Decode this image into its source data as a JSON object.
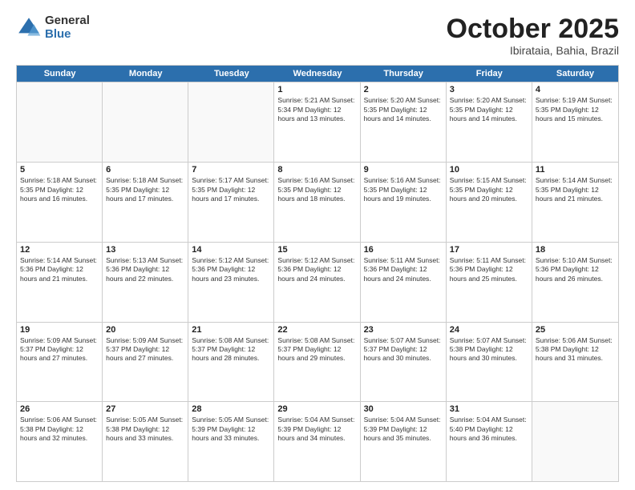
{
  "logo": {
    "general": "General",
    "blue": "Blue"
  },
  "header": {
    "month": "October 2025",
    "location": "Ibirataia, Bahia, Brazil"
  },
  "weekdays": [
    "Sunday",
    "Monday",
    "Tuesday",
    "Wednesday",
    "Thursday",
    "Friday",
    "Saturday"
  ],
  "weeks": [
    [
      {
        "day": "",
        "info": ""
      },
      {
        "day": "",
        "info": ""
      },
      {
        "day": "",
        "info": ""
      },
      {
        "day": "1",
        "info": "Sunrise: 5:21 AM\nSunset: 5:34 PM\nDaylight: 12 hours\nand 13 minutes."
      },
      {
        "day": "2",
        "info": "Sunrise: 5:20 AM\nSunset: 5:35 PM\nDaylight: 12 hours\nand 14 minutes."
      },
      {
        "day": "3",
        "info": "Sunrise: 5:20 AM\nSunset: 5:35 PM\nDaylight: 12 hours\nand 14 minutes."
      },
      {
        "day": "4",
        "info": "Sunrise: 5:19 AM\nSunset: 5:35 PM\nDaylight: 12 hours\nand 15 minutes."
      }
    ],
    [
      {
        "day": "5",
        "info": "Sunrise: 5:18 AM\nSunset: 5:35 PM\nDaylight: 12 hours\nand 16 minutes."
      },
      {
        "day": "6",
        "info": "Sunrise: 5:18 AM\nSunset: 5:35 PM\nDaylight: 12 hours\nand 17 minutes."
      },
      {
        "day": "7",
        "info": "Sunrise: 5:17 AM\nSunset: 5:35 PM\nDaylight: 12 hours\nand 17 minutes."
      },
      {
        "day": "8",
        "info": "Sunrise: 5:16 AM\nSunset: 5:35 PM\nDaylight: 12 hours\nand 18 minutes."
      },
      {
        "day": "9",
        "info": "Sunrise: 5:16 AM\nSunset: 5:35 PM\nDaylight: 12 hours\nand 19 minutes."
      },
      {
        "day": "10",
        "info": "Sunrise: 5:15 AM\nSunset: 5:35 PM\nDaylight: 12 hours\nand 20 minutes."
      },
      {
        "day": "11",
        "info": "Sunrise: 5:14 AM\nSunset: 5:35 PM\nDaylight: 12 hours\nand 21 minutes."
      }
    ],
    [
      {
        "day": "12",
        "info": "Sunrise: 5:14 AM\nSunset: 5:36 PM\nDaylight: 12 hours\nand 21 minutes."
      },
      {
        "day": "13",
        "info": "Sunrise: 5:13 AM\nSunset: 5:36 PM\nDaylight: 12 hours\nand 22 minutes."
      },
      {
        "day": "14",
        "info": "Sunrise: 5:12 AM\nSunset: 5:36 PM\nDaylight: 12 hours\nand 23 minutes."
      },
      {
        "day": "15",
        "info": "Sunrise: 5:12 AM\nSunset: 5:36 PM\nDaylight: 12 hours\nand 24 minutes."
      },
      {
        "day": "16",
        "info": "Sunrise: 5:11 AM\nSunset: 5:36 PM\nDaylight: 12 hours\nand 24 minutes."
      },
      {
        "day": "17",
        "info": "Sunrise: 5:11 AM\nSunset: 5:36 PM\nDaylight: 12 hours\nand 25 minutes."
      },
      {
        "day": "18",
        "info": "Sunrise: 5:10 AM\nSunset: 5:36 PM\nDaylight: 12 hours\nand 26 minutes."
      }
    ],
    [
      {
        "day": "19",
        "info": "Sunrise: 5:09 AM\nSunset: 5:37 PM\nDaylight: 12 hours\nand 27 minutes."
      },
      {
        "day": "20",
        "info": "Sunrise: 5:09 AM\nSunset: 5:37 PM\nDaylight: 12 hours\nand 27 minutes."
      },
      {
        "day": "21",
        "info": "Sunrise: 5:08 AM\nSunset: 5:37 PM\nDaylight: 12 hours\nand 28 minutes."
      },
      {
        "day": "22",
        "info": "Sunrise: 5:08 AM\nSunset: 5:37 PM\nDaylight: 12 hours\nand 29 minutes."
      },
      {
        "day": "23",
        "info": "Sunrise: 5:07 AM\nSunset: 5:37 PM\nDaylight: 12 hours\nand 30 minutes."
      },
      {
        "day": "24",
        "info": "Sunrise: 5:07 AM\nSunset: 5:38 PM\nDaylight: 12 hours\nand 30 minutes."
      },
      {
        "day": "25",
        "info": "Sunrise: 5:06 AM\nSunset: 5:38 PM\nDaylight: 12 hours\nand 31 minutes."
      }
    ],
    [
      {
        "day": "26",
        "info": "Sunrise: 5:06 AM\nSunset: 5:38 PM\nDaylight: 12 hours\nand 32 minutes."
      },
      {
        "day": "27",
        "info": "Sunrise: 5:05 AM\nSunset: 5:38 PM\nDaylight: 12 hours\nand 33 minutes."
      },
      {
        "day": "28",
        "info": "Sunrise: 5:05 AM\nSunset: 5:39 PM\nDaylight: 12 hours\nand 33 minutes."
      },
      {
        "day": "29",
        "info": "Sunrise: 5:04 AM\nSunset: 5:39 PM\nDaylight: 12 hours\nand 34 minutes."
      },
      {
        "day": "30",
        "info": "Sunrise: 5:04 AM\nSunset: 5:39 PM\nDaylight: 12 hours\nand 35 minutes."
      },
      {
        "day": "31",
        "info": "Sunrise: 5:04 AM\nSunset: 5:40 PM\nDaylight: 12 hours\nand 36 minutes."
      },
      {
        "day": "",
        "info": ""
      }
    ]
  ]
}
